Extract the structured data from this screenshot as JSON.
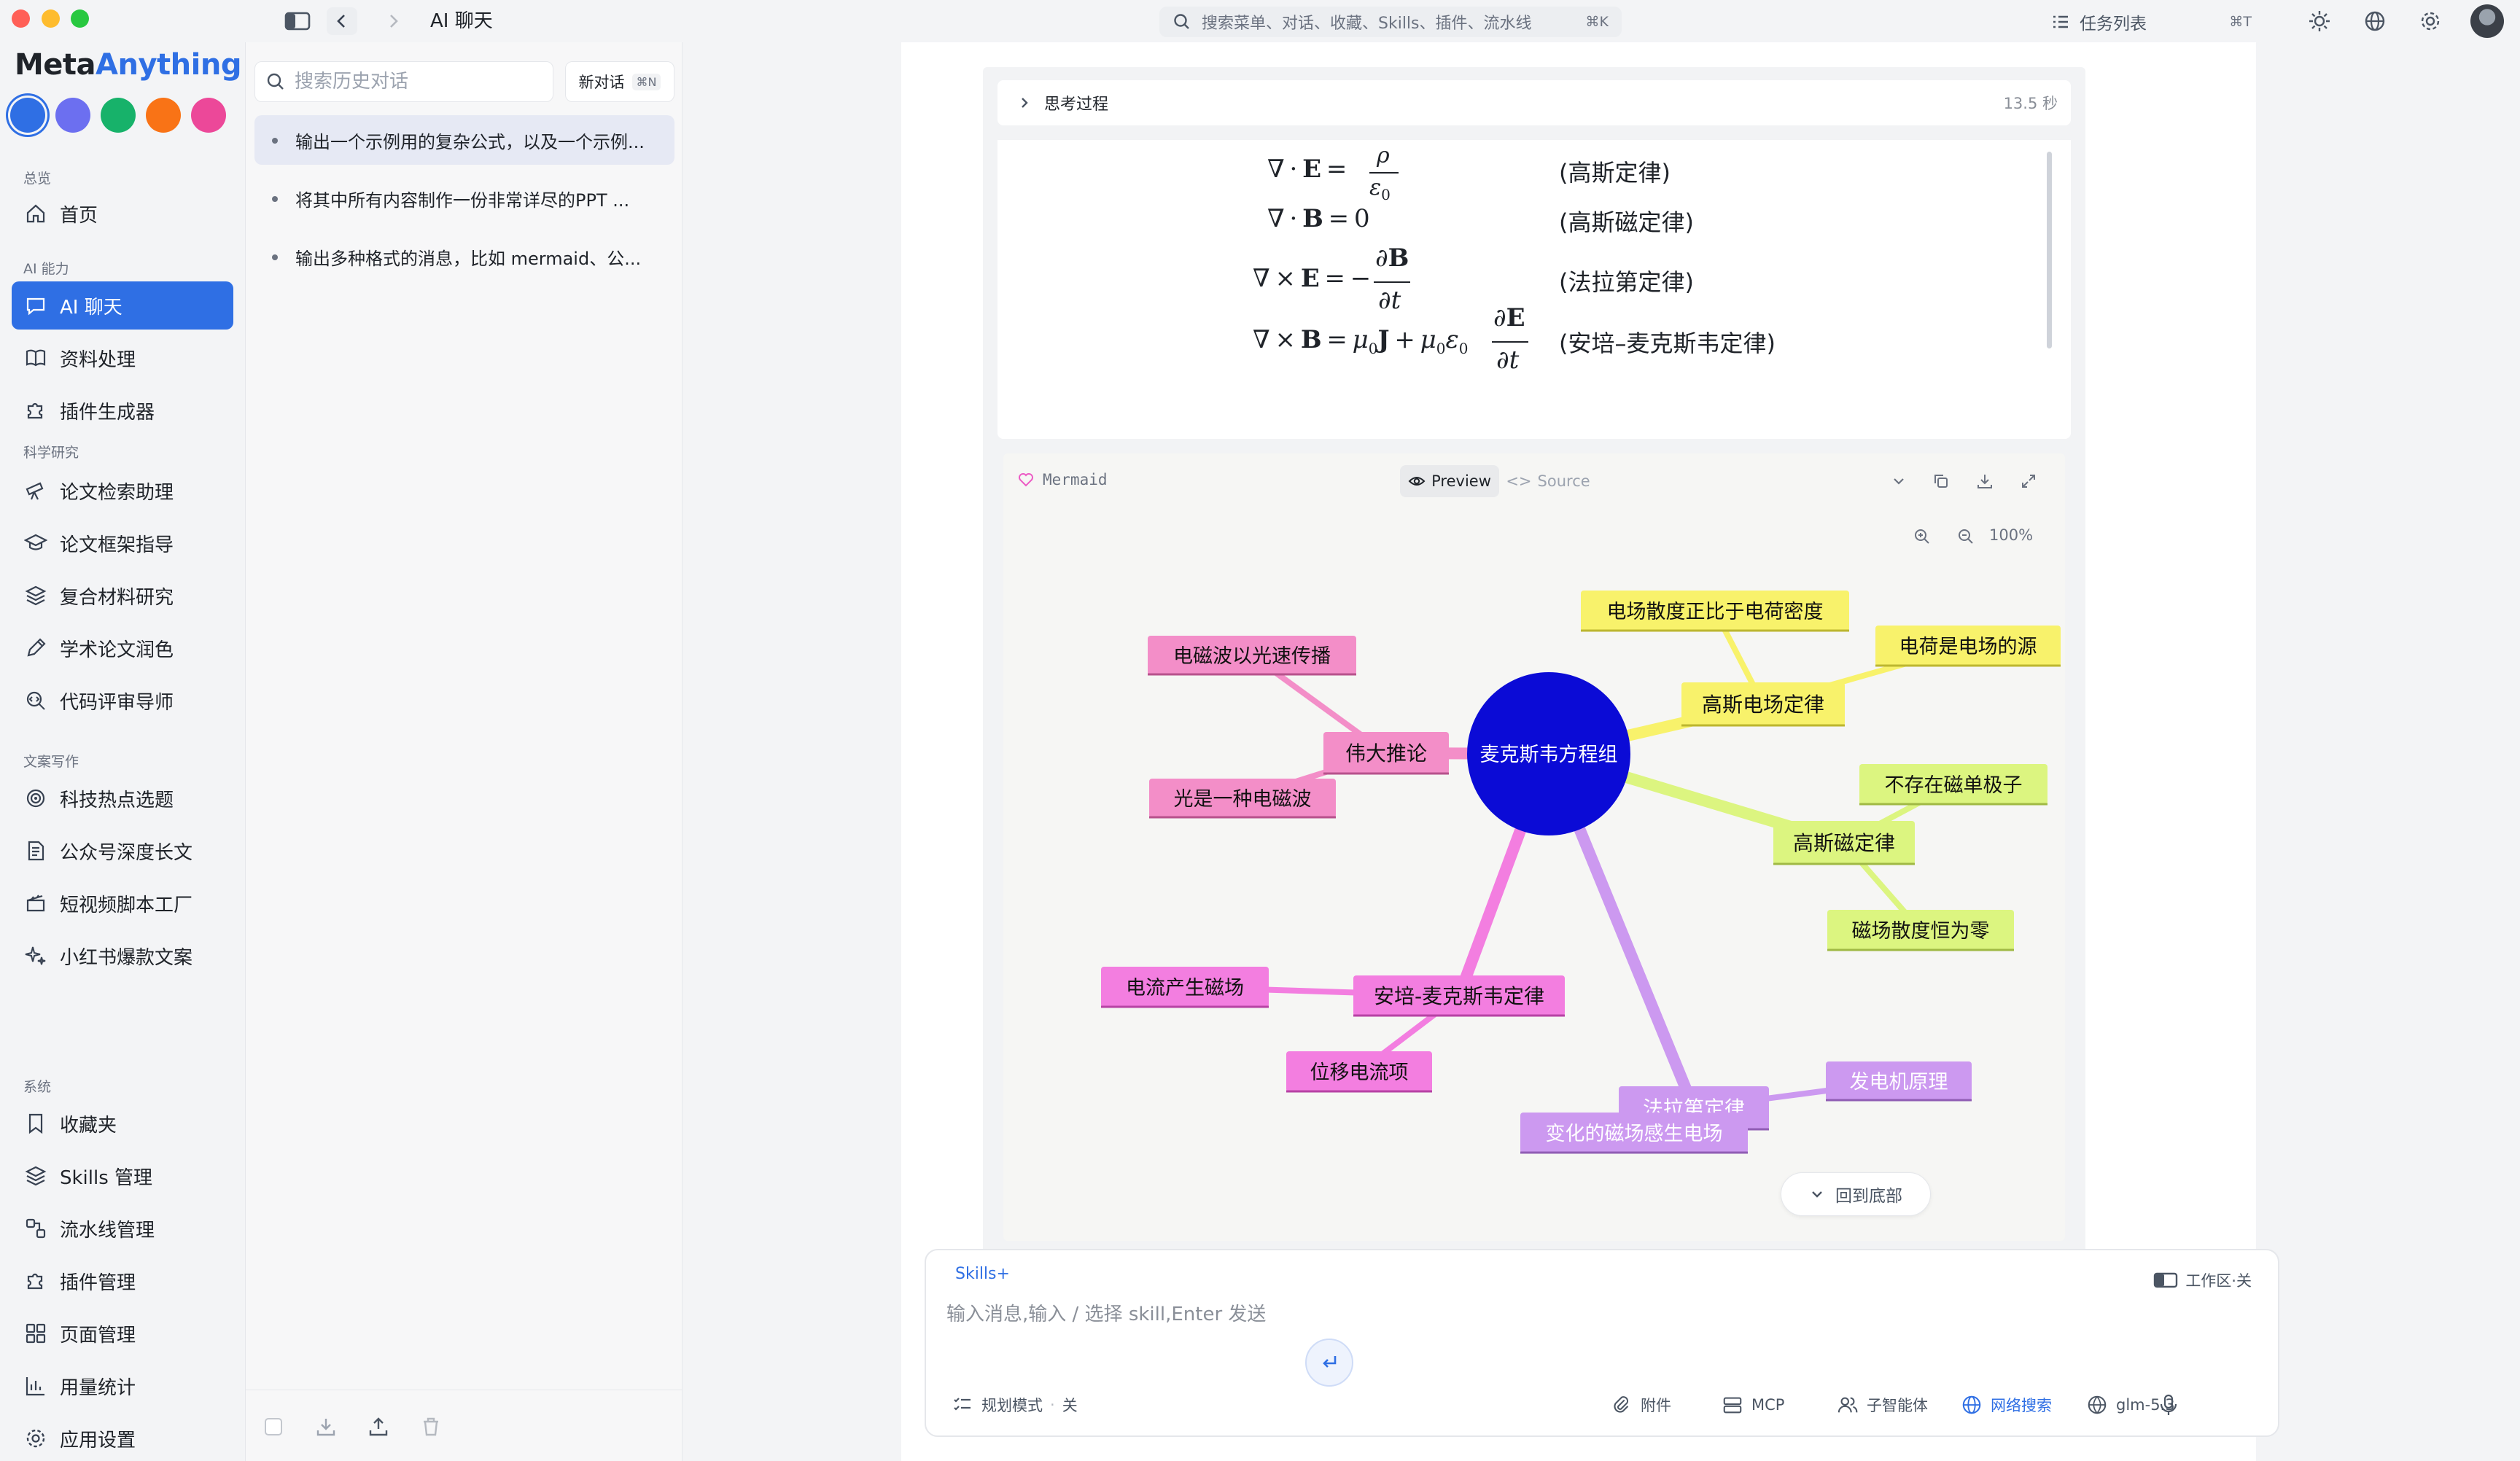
{
  "colors": {
    "accent": "#2f6fe4",
    "brand_meta": "#1f2329",
    "brand_anything": "#2f6fe4"
  },
  "titlebar": {
    "title": "AI 聊天",
    "search_placeholder": "搜索菜单、对话、收藏、Skills、插件、流水线",
    "search_shortcut": "⌘K",
    "task_list_label": "任务列表",
    "task_list_shortcut": "⌘T"
  },
  "sidebar": {
    "brand": {
      "part1": "Meta",
      "part2": "Anything"
    },
    "theme_colors": [
      "#2f6fe4",
      "#6c6ff0",
      "#17b26a",
      "#f97316",
      "#ec4899"
    ],
    "sections": [
      {
        "title": "总览",
        "items": [
          {
            "label": "首页",
            "icon": "home-icon"
          }
        ]
      },
      {
        "title": "AI 能力",
        "items": [
          {
            "label": "AI 聊天",
            "icon": "chat-icon",
            "active": true
          },
          {
            "label": "资料处理",
            "icon": "book-icon"
          },
          {
            "label": "插件生成器",
            "icon": "puzzle-icon"
          }
        ]
      },
      {
        "title": "科学研究",
        "items": [
          {
            "label": "论文检索助理",
            "icon": "telescope-icon"
          },
          {
            "label": "论文框架指导",
            "icon": "graduation-icon"
          },
          {
            "label": "复合材料研究",
            "icon": "layers-icon"
          },
          {
            "label": "学术论文润色",
            "icon": "pen-icon"
          },
          {
            "label": "代码评审导师",
            "icon": "code-search-icon"
          }
        ]
      },
      {
        "title": "文案写作",
        "items": [
          {
            "label": "科技热点选题",
            "icon": "radar-icon"
          },
          {
            "label": "公众号深度长文",
            "icon": "doc-icon"
          },
          {
            "label": "短视频脚本工厂",
            "icon": "clapper-icon"
          },
          {
            "label": "小红书爆款文案",
            "icon": "sparkle-icon"
          }
        ]
      },
      {
        "title": "系统",
        "items": [
          {
            "label": "收藏夹",
            "icon": "bookmark-icon"
          },
          {
            "label": "Skills 管理",
            "icon": "layers-icon"
          },
          {
            "label": "流水线管理",
            "icon": "workflow-icon"
          },
          {
            "label": "插件管理",
            "icon": "puzzle-icon"
          },
          {
            "label": "页面管理",
            "icon": "grid-icon"
          },
          {
            "label": "用量统计",
            "icon": "bar-chart-icon"
          },
          {
            "label": "应用设置",
            "icon": "gear-icon"
          }
        ]
      }
    ]
  },
  "history": {
    "search_placeholder": "搜索历史对话",
    "new_chat_label": "新对话",
    "new_chat_shortcut": "⌘N",
    "items": [
      "输出一个示例用的复杂公式，以及一个示例...",
      "将其中所有内容制作一份非常详尽的PPT ...",
      "输出多种格式的消息，比如 mermaid、公..."
    ]
  },
  "message": {
    "thinking_label": "思考过程",
    "thinking_time": "13.5 秒",
    "formula_labels": [
      "(高斯定律)",
      "(高斯磁定律)",
      "(法拉第定律)",
      "(安培–麦克斯韦定律)"
    ],
    "mermaid": {
      "label": "Mermaid",
      "preview_label": "Preview",
      "source_label": "Source",
      "zoom_level": "100%",
      "center": "麦克斯韦方程组",
      "branches": [
        {
          "label": "高斯电场定律",
          "color": "#f8f26b",
          "leaves": [
            "电场散度正比于电荷密度",
            "电荷是电场的源"
          ]
        },
        {
          "label": "高斯磁定律",
          "color": "#dcf580",
          "leaves": [
            "不存在磁单极子",
            "磁场散度恒为零"
          ]
        },
        {
          "label": "法拉第定律",
          "color": "#cc99f0",
          "leaves": [
            "变化的磁场感生电场",
            "发电机原理"
          ]
        },
        {
          "label": "安培-麦克斯韦定律",
          "color": "#f37ee0",
          "leaves": [
            "电流产生磁场",
            "位移电流项"
          ]
        },
        {
          "label": "伟大推论",
          "color": "#f38ec8",
          "leaves": [
            "电磁波以光速传播",
            "光是一种电磁波"
          ]
        }
      ]
    },
    "back_to_bottom": "回到底部"
  },
  "composer": {
    "skills_tag": "Skills+",
    "workspace_toggle": "工作区·关",
    "placeholder": "输入消息,输入 / 选择 skill,Enter 发送",
    "plan_mode": "规划模式",
    "plan_state": "关",
    "tools": [
      {
        "label": "附件",
        "icon": "paperclip-icon"
      },
      {
        "label": "MCP",
        "icon": "server-icon"
      },
      {
        "label": "子智能体",
        "icon": "agents-icon"
      },
      {
        "label": "网络搜索",
        "icon": "globe-icon",
        "active": true
      },
      {
        "label": "glm-5.3",
        "icon": "model-icon"
      }
    ]
  }
}
